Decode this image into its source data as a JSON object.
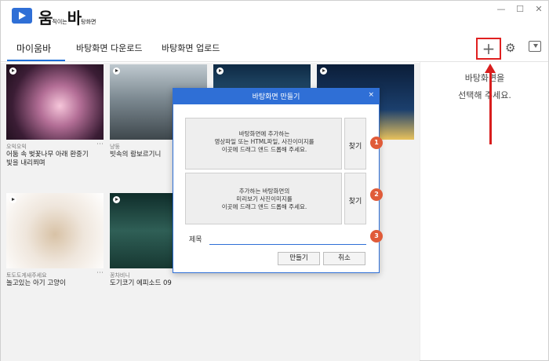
{
  "app": {
    "name": "움",
    "name_mid": "직이는",
    "name_big": "바",
    "name_end": "탕화면"
  },
  "window_controls": {
    "minimize": "—",
    "maximize": "☐",
    "close": "✕"
  },
  "tabs": [
    {
      "label": "마이움바",
      "active": true
    },
    {
      "label": "바탕화면 다운로드",
      "active": false
    },
    {
      "label": "바탕화면 업로드",
      "active": false
    }
  ],
  "toolbar": {
    "add_label": "+",
    "settings_icon": "gear-icon",
    "download_icon": "download-icon"
  },
  "right_panel": {
    "line1": "바탕화면을",
    "line2": "선택해 주세요."
  },
  "gallery": {
    "items": [
      {
        "author": "오익오익",
        "title": "어둠 속 벚꽃나무 아래 환중기\n빛을 내리쬐며"
      },
      {
        "author": "냥둥",
        "title": "빗속의 람보르기니"
      },
      {
        "author": "",
        "title": ""
      },
      {
        "author": "",
        "title": ""
      },
      {
        "author": "토도도게새주세요",
        "title": "놀고있는 아기 고양이"
      },
      {
        "author": "꽁차비니",
        "title": "도기코기 에피소드 09"
      }
    ],
    "more_icon": "⋯"
  },
  "dialog": {
    "title": "바탕화면 만들기",
    "close": "×",
    "box1": {
      "line1": "바탕화면에 추가하는",
      "line2": "영상파일 또는 HTML파일, 사진이미지를",
      "line3": "이곳에 드래그 앤드 드롭해 주세요."
    },
    "box2": {
      "line1": "추가하는 바탕화면의",
      "line2": "미리보기 사진이미지를",
      "line3": "이곳에 드래그 앤드 드롭해 주세요."
    },
    "find_label": "찾기",
    "title_label": "제목",
    "title_value": "",
    "create_label": "만들기",
    "cancel_label": "취소",
    "step_numbers": [
      "1",
      "2",
      "3"
    ]
  },
  "colors": {
    "accent": "#2f6fd6",
    "highlight": "#e02020",
    "step_badge": "#e05b39"
  }
}
